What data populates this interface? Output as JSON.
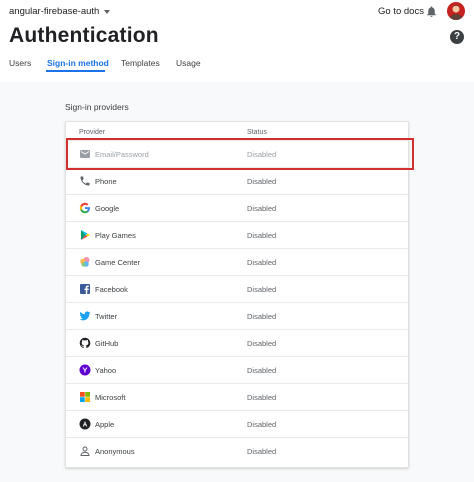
{
  "header": {
    "project_name": "angular-firebase-auth",
    "docs_link": "Go to docs",
    "title": "Authentication"
  },
  "tabs": [
    {
      "label": "Users"
    },
    {
      "label": "Sign-in method"
    },
    {
      "label": "Templates"
    },
    {
      "label": "Usage"
    }
  ],
  "section_label": "Sign-in providers",
  "table": {
    "headers": {
      "provider": "Provider",
      "status": "Status"
    },
    "rows": [
      {
        "provider": "Email/Password",
        "status": "Disabled",
        "icon": "mail-icon"
      },
      {
        "provider": "Phone",
        "status": "Disabled",
        "icon": "phone-icon"
      },
      {
        "provider": "Google",
        "status": "Disabled",
        "icon": "google-icon"
      },
      {
        "provider": "Play Games",
        "status": "Disabled",
        "icon": "play-games-icon"
      },
      {
        "provider": "Game Center",
        "status": "Disabled",
        "icon": "game-center-icon"
      },
      {
        "provider": "Facebook",
        "status": "Disabled",
        "icon": "facebook-icon"
      },
      {
        "provider": "Twitter",
        "status": "Disabled",
        "icon": "twitter-icon"
      },
      {
        "provider": "GitHub",
        "status": "Disabled",
        "icon": "github-icon"
      },
      {
        "provider": "Yahoo",
        "status": "Disabled",
        "icon": "yahoo-icon"
      },
      {
        "provider": "Microsoft",
        "status": "Disabled",
        "icon": "microsoft-icon"
      },
      {
        "provider": "Apple",
        "status": "Disabled",
        "icon": "apple-icon"
      },
      {
        "provider": "Anonymous",
        "status": "Disabled",
        "icon": "anonymous-icon"
      }
    ]
  },
  "colors": {
    "accent": "#1a73e8",
    "highlight": "#d32f2f",
    "background": "#f8f9fa"
  }
}
